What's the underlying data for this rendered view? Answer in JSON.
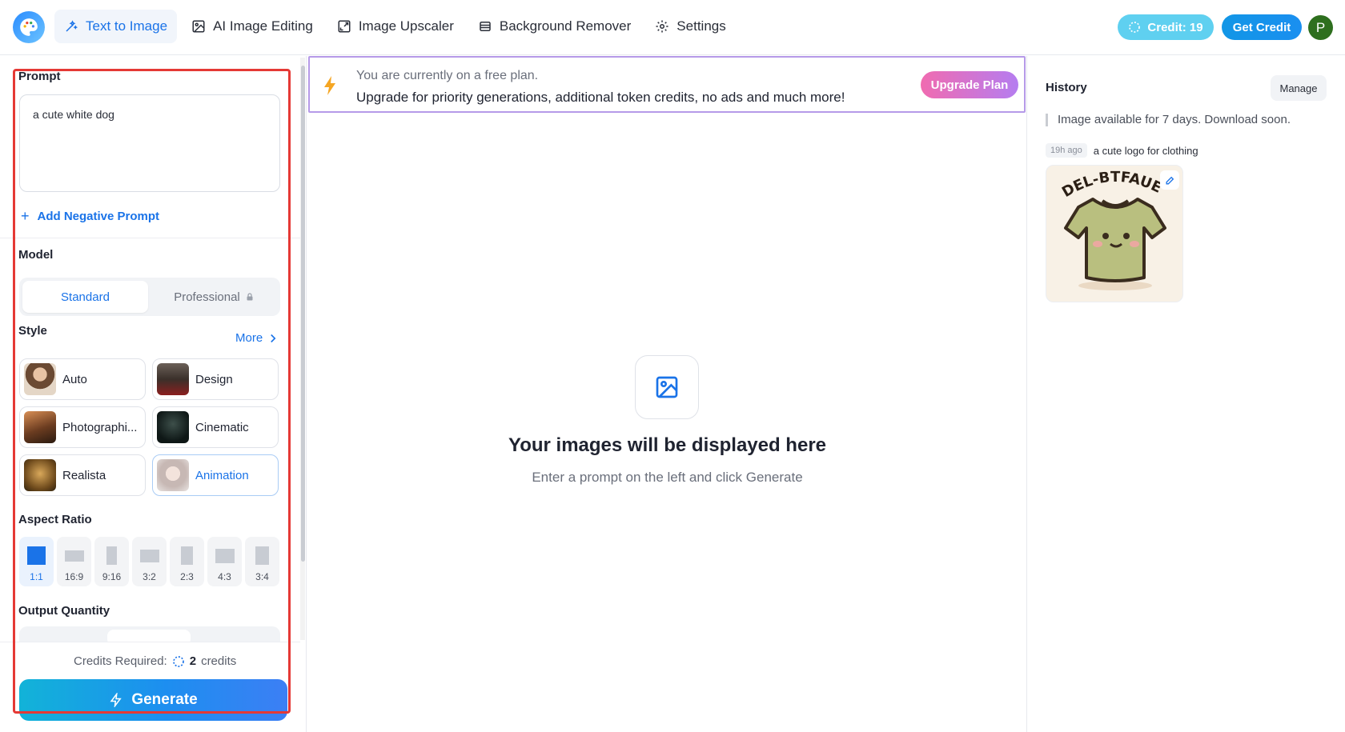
{
  "nav": {
    "items": [
      {
        "label": "Text to Image",
        "icon": "magic-wand-icon"
      },
      {
        "label": "AI Image Editing",
        "icon": "image-edit-icon"
      },
      {
        "label": "Image Upscaler",
        "icon": "expand-icon"
      },
      {
        "label": "Background Remover",
        "icon": "eraser-icon"
      },
      {
        "label": "Settings",
        "icon": "gear-icon"
      }
    ],
    "credit_label": "Credit: 19",
    "get_credit_label": "Get Credit",
    "avatar_letter": "P"
  },
  "left": {
    "prompt_label": "Prompt",
    "prompt_value": "a cute white dog",
    "negative_prompt_label": "Add Negative Prompt",
    "model_label": "Model",
    "model_options": [
      "Standard",
      "Professional"
    ],
    "model_selected": "Standard",
    "style_label": "Style",
    "style_more": "More",
    "styles": [
      "Auto",
      "Design",
      "Photographi...",
      "Cinematic",
      "Realista",
      "Animation"
    ],
    "style_selected": "Animation",
    "aspect_label": "Aspect Ratio",
    "aspect_ratios": [
      "1:1",
      "16:9",
      "9:16",
      "3:2",
      "2:3",
      "4:3",
      "3:4"
    ],
    "aspect_selected": "1:1",
    "quantity_label": "Output Quantity",
    "credits_required_label": "Credits Required:",
    "credits_required_value": "2",
    "credits_required_unit": "credits",
    "generate_label": "Generate"
  },
  "banner": {
    "line1": "You are currently on a free plan.",
    "line2": "Upgrade for priority generations, additional token credits, no ads and much more!",
    "button": "Upgrade Plan"
  },
  "main": {
    "empty_title": "Your images will be displayed here",
    "empty_subtitle": "Enter a prompt on the left and click Generate"
  },
  "history": {
    "title": "History",
    "manage_label": "Manage",
    "notice": "Image available for 7 days. Download soon.",
    "items": [
      {
        "ago": "19h ago",
        "prompt": "a cute logo for clothing",
        "image_text": "DEL-BTFAUE"
      }
    ]
  },
  "colors": {
    "accent": "#1a73e8",
    "credit_pill": "#5fd0f0",
    "highlight_frame": "#e53935"
  }
}
